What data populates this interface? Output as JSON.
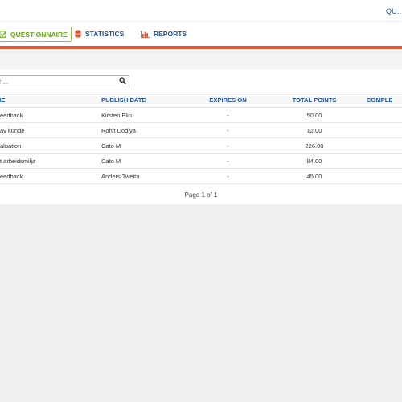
{
  "header": {
    "user_link": "QU..."
  },
  "tabs": [
    {
      "label": "QUESTIONNAIRE",
      "icon": "checkbox-icon",
      "active": true,
      "color": "#6aa51c"
    },
    {
      "label": "STATISTICS",
      "icon": "database-icon",
      "active": false,
      "color": "#e8583c"
    },
    {
      "label": "REPORTS",
      "icon": "bar-chart-icon",
      "active": false,
      "color": "#e8583c"
    }
  ],
  "accent_color": "#e8583c",
  "search": {
    "placeholder": "h..."
  },
  "table": {
    "headers": [
      "ME",
      "PUBLISH DATE",
      "EXPIRES ON",
      "TOTAL POINTS",
      "COMPLE"
    ],
    "rows": [
      {
        "name": "eedback",
        "publisher": "Kirsten Elin",
        "expires": "-",
        "points": "50.00"
      },
      {
        "name": "av kunde",
        "publisher": "Rohit Dodiya",
        "expires": "-",
        "points": "12.00"
      },
      {
        "name": "aluation",
        "publisher": "Cato M",
        "expires": "-",
        "points": "226.00"
      },
      {
        "name": "t arbeidsmiljø",
        "publisher": "Cato M",
        "expires": "-",
        "points": "84.00"
      },
      {
        "name": "eedback",
        "publisher": "Anders Tweita",
        "expires": "-",
        "points": "45.00"
      }
    ]
  },
  "pager": {
    "text": "Page 1 of 1"
  }
}
